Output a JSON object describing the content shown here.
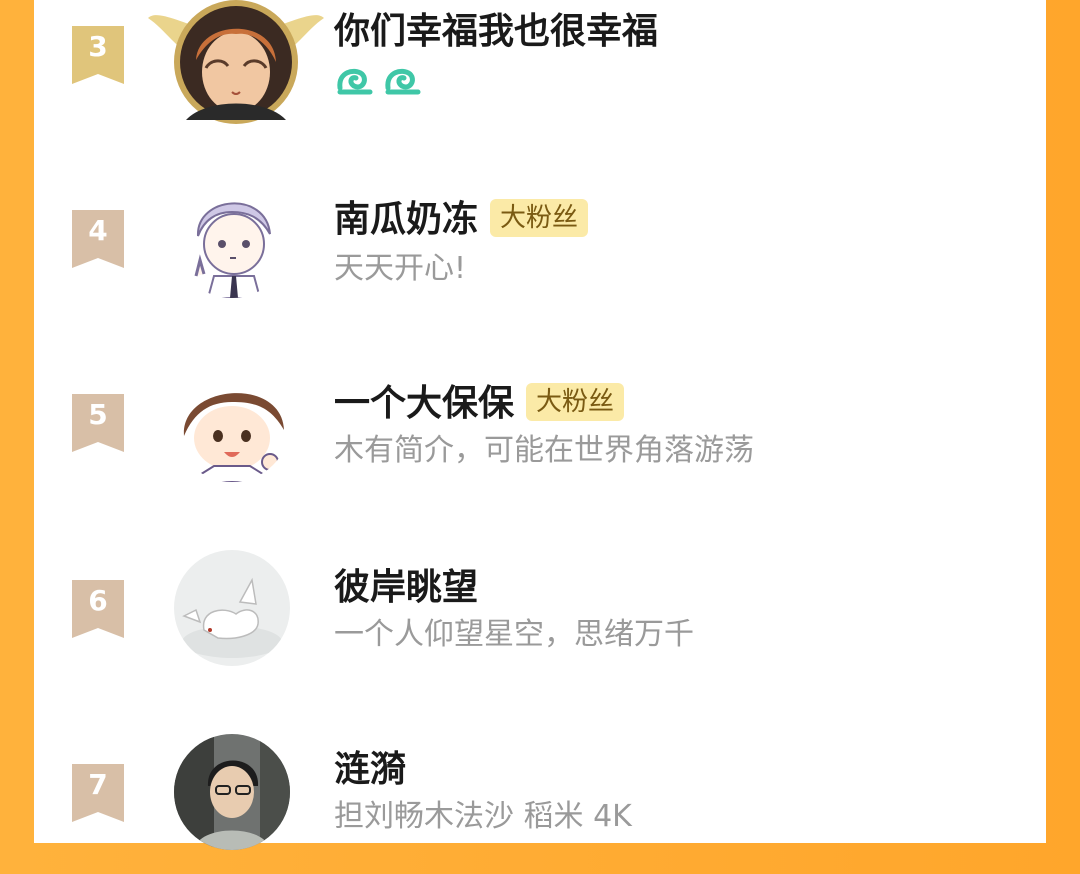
{
  "colors": {
    "background": "#ffa62b",
    "card": "#ffffff",
    "top3_ribbon": "#e0c57b",
    "ribbon": "#d8bfa7",
    "badge_bg": "#fbeaa7",
    "name": "#1a1a1a",
    "desc": "#9a9a9a",
    "swirl": "#3fc7a7"
  },
  "fans": [
    {
      "rank": "3",
      "name": "你们幸福我也很幸福",
      "badge": "",
      "desc": "",
      "icons": [
        "swirl-icon",
        "swirl-icon"
      ],
      "avatar": "anime-boy-orange-hair",
      "frame": "gold-wings"
    },
    {
      "rank": "4",
      "name": "南瓜奶冻",
      "badge": "大粉丝",
      "desc": "天天开心!",
      "avatar": "chibi-silver-hair-peace-sign"
    },
    {
      "rank": "5",
      "name": "一个大保保",
      "badge": "大粉丝",
      "desc": "木有简介，可能在世界角落游荡",
      "avatar": "chibi-brown-hair"
    },
    {
      "rank": "6",
      "name": "彼岸眺望",
      "badge": "",
      "desc": "一个人仰望星空，思绪万千",
      "avatar": "white-fox-ink"
    },
    {
      "rank": "7",
      "name": "涟漪",
      "badge": "",
      "desc": "担刘畅木法沙 稻米 4K",
      "avatar": "man-with-glasses"
    }
  ]
}
